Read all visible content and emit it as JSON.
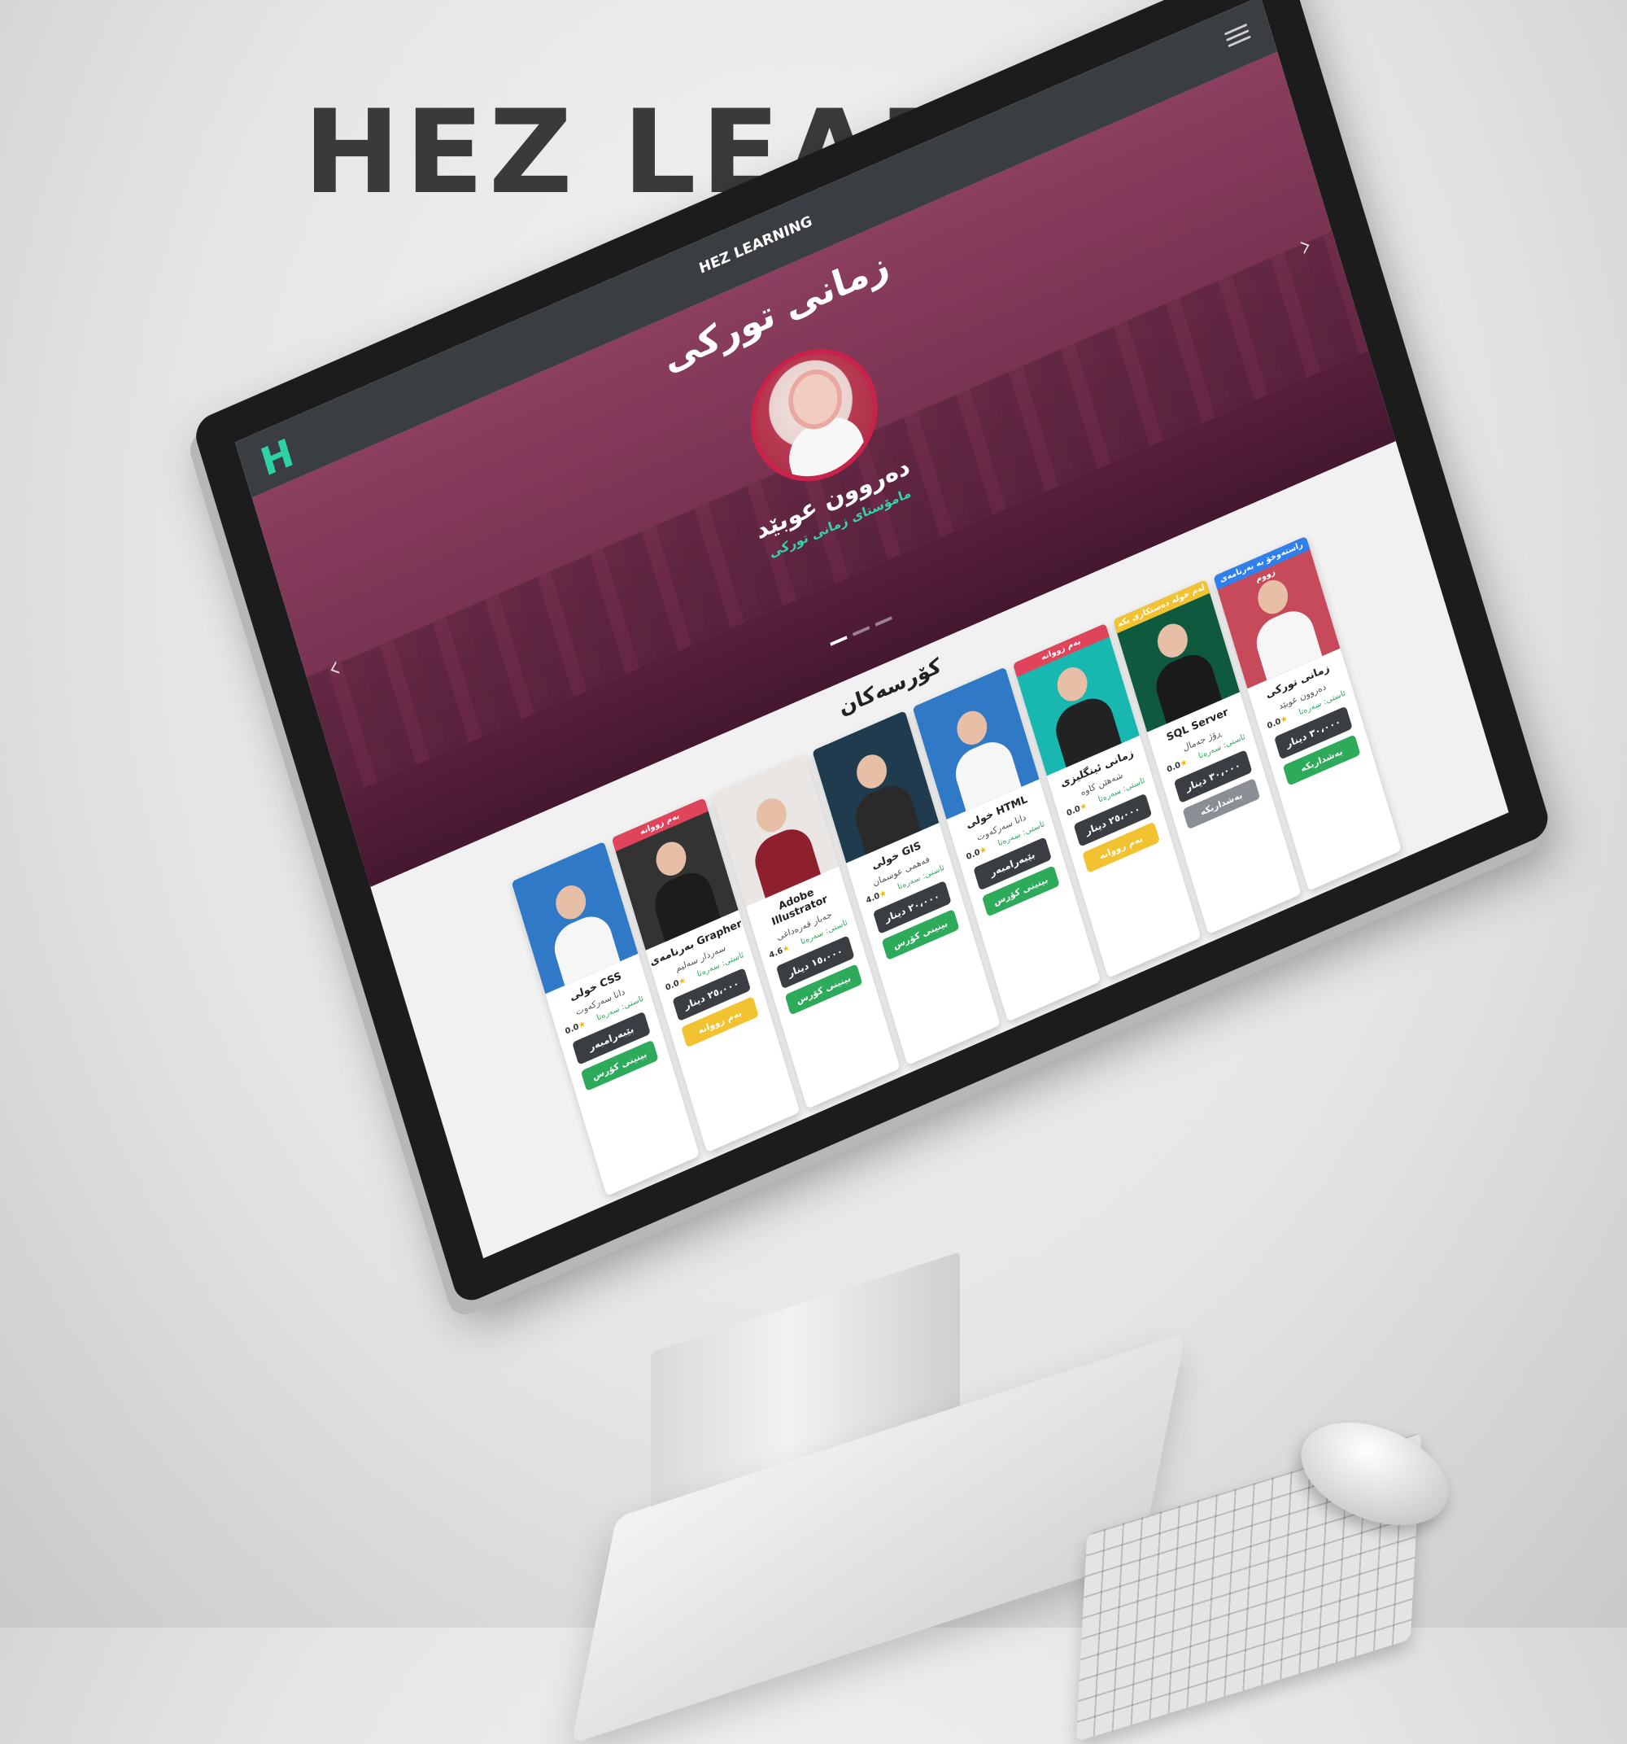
{
  "mockup": {
    "title": "HEZ LEARNING"
  },
  "navbar": {
    "logo": "H",
    "brand": "HEZ LEARNING"
  },
  "hero": {
    "title": "زمانی تورکی",
    "teacher_name": "دەروون عوبێد",
    "teacher_role": "مامۆستای زمانی تورکی",
    "prev_arrow": "‹",
    "next_arrow": "›",
    "slides_count": 3,
    "active_slide": 1
  },
  "courses_section": {
    "title": "کۆرسەکان"
  },
  "courses": [
    {
      "title": "زمانی تورکی",
      "teacher": "دەروون عوبێد",
      "level": "ئاستی: سەرەتا",
      "rating": "0.0",
      "price": "٣٠،٠٠٠ دینار",
      "ribbon": "راستەوخۆ بە بەرنامەی زووم",
      "ribbon_color": "#2f80ed",
      "photo_bg": "#c74a5a",
      "torso_color": "#f6f6f6",
      "action": "بەشداربکە",
      "action_color": "#2eaa5b"
    },
    {
      "title": "SQL Server",
      "teacher": "ڕۆژ جەمال",
      "level": "ئاستی: سەرەتا",
      "rating": "0.0",
      "price": "٣٠،٠٠٠ دینار",
      "ribbon": "لەم خولە دەستکاری بکە",
      "ribbon_color": "#f2c230",
      "photo_bg": "#0f5a3e",
      "torso_color": "#1a1a1a",
      "action": "بەشداربکە",
      "action_color": "#8a8f96"
    },
    {
      "title": "زمانی ئینگلیزی",
      "teacher": "شەهێن کاوە",
      "level": "ئاستی: سەرەتا",
      "rating": "0.0",
      "price": "٢٥،٠٠٠ دینار",
      "ribbon": "بەم زووانە",
      "ribbon_color": "#e0445a",
      "photo_bg": "#18b7b0",
      "torso_color": "#222222",
      "action": "بەم زووانە",
      "action_color": "#f2c230"
    },
    {
      "title": "خولی HTML",
      "teacher": "دانا سەرکەوت",
      "level": "ئاستی: سەرەتا",
      "rating": "0.0",
      "price": "بێبەرامبەر",
      "ribbon": "",
      "ribbon_color": "",
      "photo_bg": "#2f79c6",
      "torso_color": "#f6f6f6",
      "action": "بینینی کۆرس",
      "action_color": "#2eaa5b"
    },
    {
      "title": "خولی GIS",
      "teacher": "فەهمی عوسمان",
      "level": "ئاستی: سەرەتا",
      "rating": "4.0",
      "price": "٢٠،٠٠٠ دینار",
      "ribbon": "",
      "ribbon_color": "",
      "photo_bg": "#1f3b4d",
      "torso_color": "#2a2a2a",
      "action": "بینینی کۆرس",
      "action_color": "#2eaa5b"
    },
    {
      "title": "Adobe Illustrator",
      "teacher": "جەبار قەرەداغی",
      "level": "ئاستی: سەرەتا",
      "rating": "4.6",
      "price": "١٥،٠٠٠ دینار",
      "ribbon": "",
      "ribbon_color": "",
      "photo_bg": "#e9e6e3",
      "torso_color": "#8e1f2c",
      "action": "بینینی کۆرس",
      "action_color": "#2eaa5b"
    },
    {
      "title": "بەرنامەی Grapher",
      "teacher": "سەردار سەلیم",
      "level": "ئاستی: سەرەتا",
      "rating": "0.0",
      "price": "٢٥،٠٠٠ دینار",
      "ribbon": "بەم زووانە",
      "ribbon_color": "#e0445a",
      "photo_bg": "#333333",
      "torso_color": "#1c1c1c",
      "action": "بەم زووانە",
      "action_color": "#f2c230"
    },
    {
      "title": "خولی CSS",
      "teacher": "دانا سەرکەوت",
      "level": "ئاستی: سەرەتا",
      "rating": "0.0",
      "price": "بێبەرامبەر",
      "ribbon": "",
      "ribbon_color": "",
      "photo_bg": "#2f79c6",
      "torso_color": "#f6f6f6",
      "action": "بینینی کۆرس",
      "action_color": "#2eaa5b"
    }
  ],
  "colors": {
    "accent": "#2ed3a5",
    "navbar": "#3a3d41",
    "hero_overlay": "#8c2d55"
  }
}
